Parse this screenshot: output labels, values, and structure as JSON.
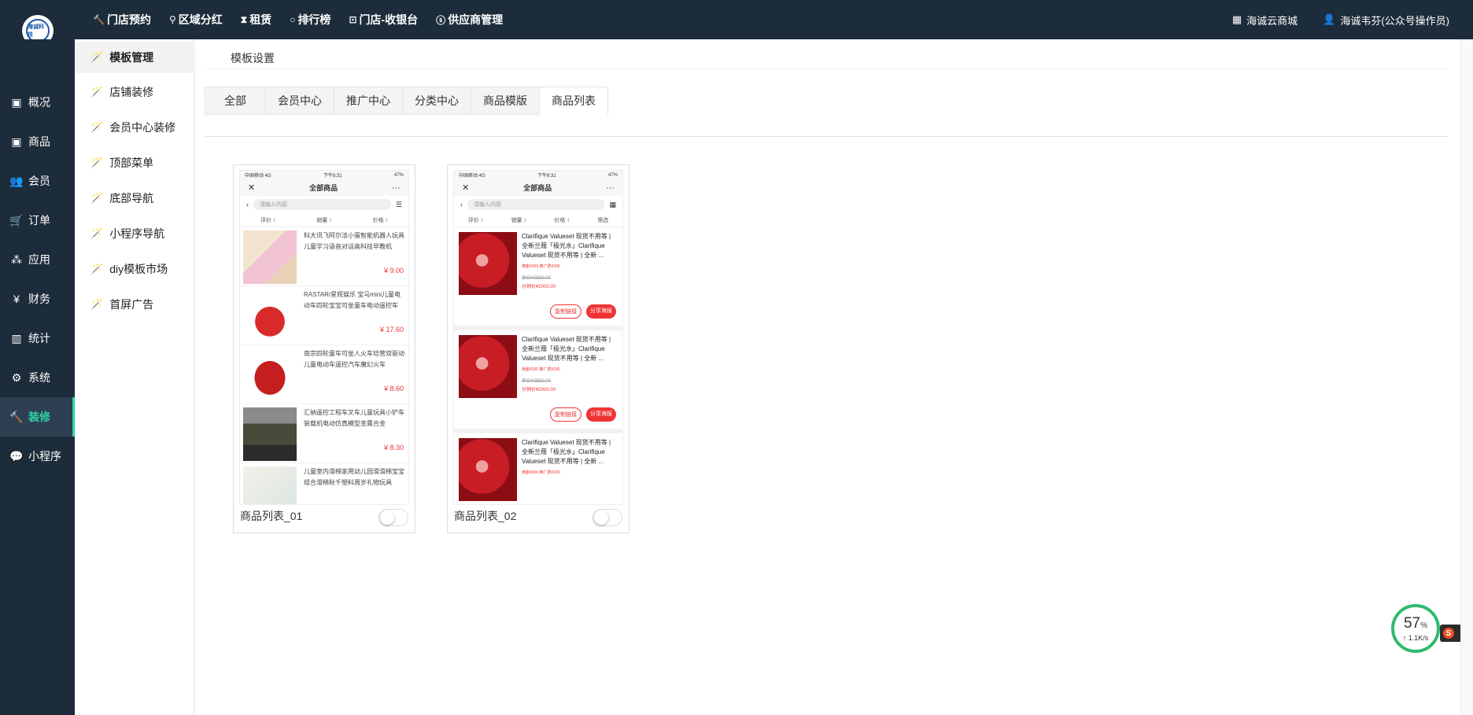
{
  "topbar": {
    "logo_text": "海诚科技",
    "nav": [
      {
        "icon": "hammer-icon",
        "glyph": "🔨",
        "label": "门店预约"
      },
      {
        "icon": "pin-icon",
        "glyph": "⚲",
        "label": "区域分红"
      },
      {
        "icon": "hourglass-icon",
        "glyph": "⧗",
        "label": "租赁"
      },
      {
        "icon": "circle-icon",
        "glyph": "○",
        "label": "排行榜"
      },
      {
        "icon": "cash-icon",
        "glyph": "⊡",
        "label": "门店-收银台"
      },
      {
        "icon": "skype-icon",
        "glyph": "ⓢ",
        "label": "供应商管理"
      }
    ],
    "right": [
      {
        "icon": "grid-icon",
        "glyph": "▦",
        "label": "海诚云商城"
      },
      {
        "icon": "user-icon",
        "glyph": "👤",
        "label": "海诚韦芬(公众号操作员)"
      }
    ]
  },
  "sidebar": {
    "items": [
      {
        "icon": "box-icon",
        "glyph": "▣",
        "label": "概况"
      },
      {
        "icon": "box-icon",
        "glyph": "▣",
        "label": "商品"
      },
      {
        "icon": "users-icon",
        "glyph": "👥",
        "label": "会员"
      },
      {
        "icon": "cart-icon",
        "glyph": "🛒",
        "label": "订单"
      },
      {
        "icon": "cubes-icon",
        "glyph": "⁂",
        "label": "应用"
      },
      {
        "icon": "yen-icon",
        "glyph": "¥",
        "label": "财务"
      },
      {
        "icon": "bar-chart-icon",
        "glyph": "▥",
        "label": "统计"
      },
      {
        "icon": "gears-icon",
        "glyph": "⚙",
        "label": "系统"
      },
      {
        "icon": "hammer-icon",
        "glyph": "🔨",
        "label": "装修"
      },
      {
        "icon": "wechat-icon",
        "glyph": "💬",
        "label": "小程序"
      }
    ],
    "active_index": 8
  },
  "submenu": {
    "items": [
      "模板管理",
      "店铺装修",
      "会员中心装修",
      "顶部菜单",
      "底部导航",
      "小程序导航",
      "diy模板市场",
      "首屏广告"
    ],
    "active_index": 0
  },
  "main": {
    "title": "模板设置",
    "tabs": [
      "全部",
      "会员中心",
      "推广中心",
      "分类中心",
      "商品模版",
      "商品列表"
    ],
    "active_tab": 5
  },
  "cards": [
    {
      "name": "商品列表_01",
      "enabled": false,
      "phone": {
        "status_left": "中国移动  4G",
        "status_center": "下午8:31",
        "status_right": "47%",
        "title": "全部商品",
        "search_placeholder": "请输入内容",
        "sort": [
          "评价 ↕",
          "销量 ↕",
          "价格 ↕"
        ],
        "items": [
          {
            "name": "科大讯飞阿尔法小蛋智能机器人玩具儿童学习语音对话高科技早教机",
            "price": "¥ 9.00"
          },
          {
            "name": "RASTAR/星辉娱乐 宝马mini儿童电动车四轮宝宝可坐童车电动遥控车",
            "price": "¥ 17.60"
          },
          {
            "name": "南宗四轮童车可坐人火车培营双驱动儿童电动车遥控汽车魔幻火车",
            "price": "¥ 8.60"
          },
          {
            "name": "汇纳遥控工程车叉车儿童玩具小铲车装载机电动仿真模型金属合金",
            "price": "¥ 8.30"
          },
          {
            "name": "儿童室内滑梯家用幼儿园滑滑梯宝宝组合滑梯秋千塑料周岁礼物玩具",
            "price": ""
          }
        ]
      }
    },
    {
      "name": "商品列表_02",
      "enabled": false,
      "phone": {
        "status_left": "中国移动  4G",
        "status_center": "下午8:31",
        "status_right": "47%",
        "title": "全部商品",
        "search_placeholder": "请输入内容",
        "sort": [
          "评价 ↕",
          "销量 ↕",
          "价格 ↕",
          "筛选"
        ],
        "items": [
          {
            "name": "Clarifique Valueset 现货不用等 | 全新兰蔻「极光水」Clarifique Valueset 现货不用等 | 全新 ...",
            "tags": "佣金¥200   推广费¥200",
            "old": "原价¥2580.00",
            "sale": "分销价¥2000.00",
            "btn1": "复制链接",
            "btn2": "分享海报"
          },
          {
            "name": "Clarifique Valueset 现货不用等 | 全新兰蔻「极光水」Clarifique Valueset 现货不用等 | 全新 ...",
            "tags": "佣金¥200   推广费¥200",
            "old": "原价¥2580.00",
            "sale": "分销价¥2000.00",
            "btn1": "复制链接",
            "btn2": "分享海报"
          },
          {
            "name": "Clarifique Valueset 现货不用等 | 全新兰蔻「极光水」Clarifique Valueset 现货不用等 | 全新 ...",
            "tags": "佣金¥200   推广费¥200",
            "old": "",
            "sale": "",
            "btn1": "",
            "btn2": ""
          }
        ]
      }
    }
  ],
  "speed_widget": {
    "percent": "57",
    "unit": "%",
    "rate": "↑ 1.1K/s"
  },
  "colors": {
    "topbar": "#1d2c3a",
    "accent": "#2dd4a7",
    "price": "#e33333"
  }
}
